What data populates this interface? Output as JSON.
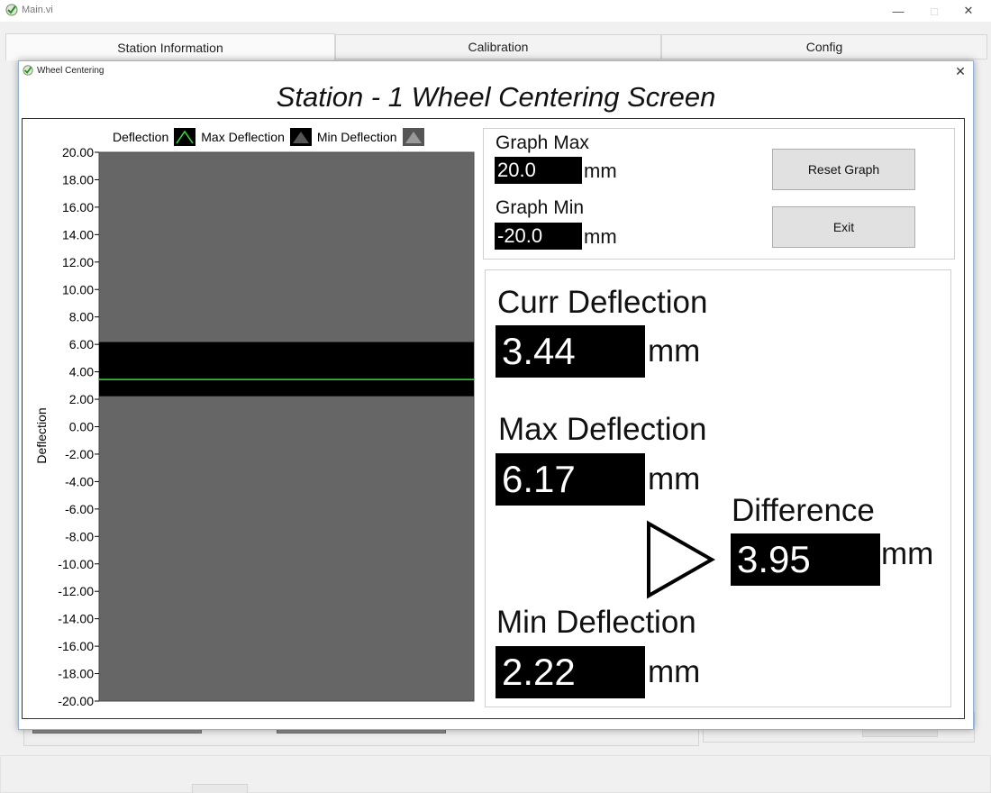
{
  "app": {
    "window_title": "Main.vi"
  },
  "tabs": [
    {
      "label": "Station Information"
    },
    {
      "label": "Calibration"
    },
    {
      "label": "Config"
    }
  ],
  "dialog": {
    "title": "Wheel Centering",
    "screen_title": "Station - 1 Wheel Centering Screen"
  },
  "legend": {
    "label": "Deflection",
    "max_label": "Max Deflection",
    "min_label": "Min Deflection"
  },
  "graph_settings": {
    "max_label": "Graph Max",
    "max_value": "20.0",
    "min_label": "Graph Min",
    "min_value": "-20.0",
    "unit": "mm"
  },
  "buttons": {
    "reset_graph": "Reset Graph",
    "exit": "Exit"
  },
  "readouts": {
    "curr_label": "Curr Deflection",
    "curr_value": "3.44",
    "max_label": "Max Deflection",
    "max_value": "6.17",
    "min_label": "Min Deflection",
    "min_value": "2.22",
    "diff_label": "Difference",
    "diff_value": "3.95",
    "unit": "mm"
  },
  "colors": {
    "plot_bg": "#666666",
    "band": "#000000",
    "current_line": "#33e033",
    "field_bg": "#000000",
    "field_text": "#ffffff"
  },
  "chart_data": {
    "type": "line",
    "ylabel": "Deflection",
    "ylim": [
      -20,
      20
    ],
    "yticks": [
      "20.00",
      "18.00",
      "16.00",
      "14.00",
      "12.00",
      "10.00",
      "8.00",
      "6.00",
      "4.00",
      "2.00",
      "0.00",
      "-2.00",
      "-4.00",
      "-6.00",
      "-8.00",
      "-10.00",
      "-12.00",
      "-14.00",
      "-16.00",
      "-18.00",
      "-20.00"
    ],
    "current": 3.44,
    "band": {
      "max": 6.17,
      "min": 2.22
    }
  }
}
